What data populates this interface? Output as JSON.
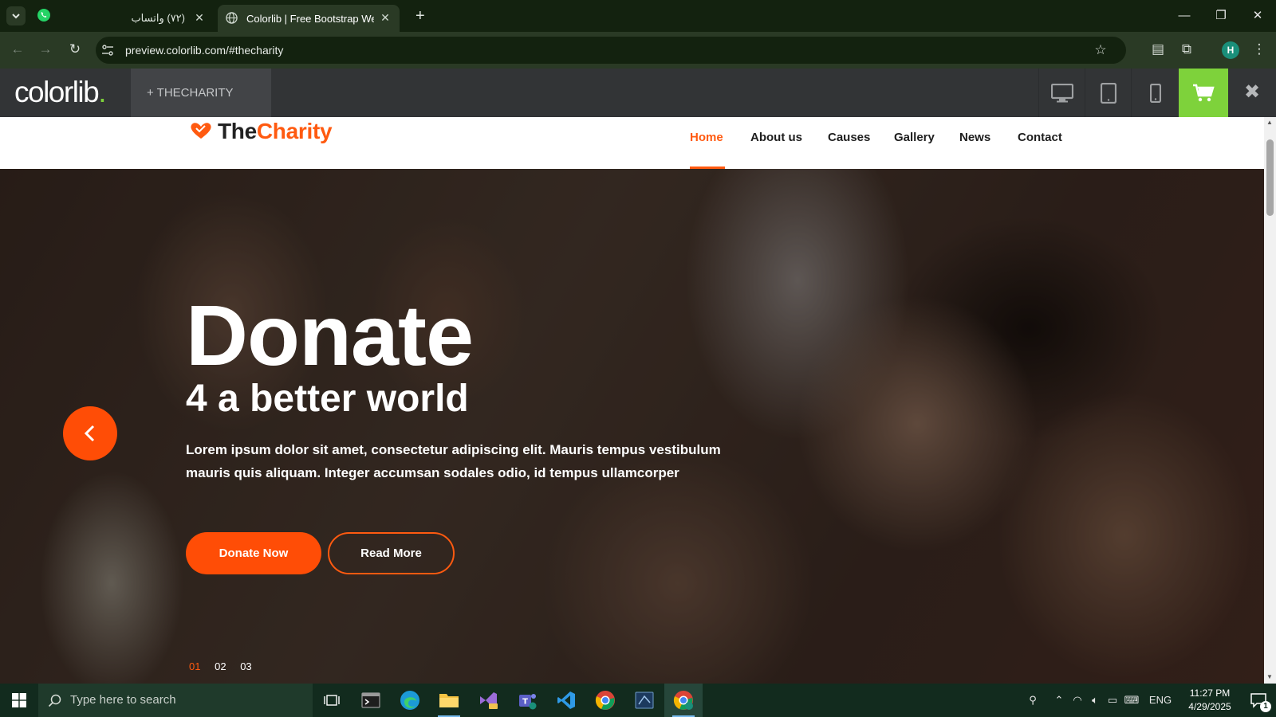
{
  "browser": {
    "tabs": [
      {
        "label": "(٧٢) واتساب",
        "icon": "whatsapp-icon",
        "active": false
      },
      {
        "label": "Colorlib | Free Bootstrap Websit",
        "icon": "globe-icon",
        "active": true
      }
    ],
    "url": "preview.colorlib.com/#thecharity",
    "profile_initial": "H"
  },
  "colorlib_bar": {
    "logo_text": "colorlib",
    "logo_dot": ".",
    "site_label": "+  THECHARITY",
    "accent": "#7ed23b"
  },
  "site": {
    "brand_the": "The",
    "brand_charity": "Charity",
    "accent": "#ff5a10",
    "nav": [
      "Home",
      "About us",
      "Causes",
      "Gallery",
      "News",
      "Contact"
    ],
    "active_nav": "Home",
    "hero": {
      "title": "Donate",
      "subtitle": "4 a better world",
      "text": "Lorem ipsum dolor sit amet, consectetur adipiscing elit. Mauris tempus vestibulum mauris quis aliquam. Integer accumsan sodales odio, id tempus ullamcorper",
      "primary_button": "Donate Now",
      "secondary_button": "Read More",
      "slides": [
        "01",
        "02",
        "03"
      ],
      "current_slide": "01"
    }
  },
  "taskbar": {
    "search_placeholder": "Type here to search",
    "language": "ENG",
    "time": "11:27 PM",
    "date": "4/29/2025",
    "notification_count": "1"
  }
}
